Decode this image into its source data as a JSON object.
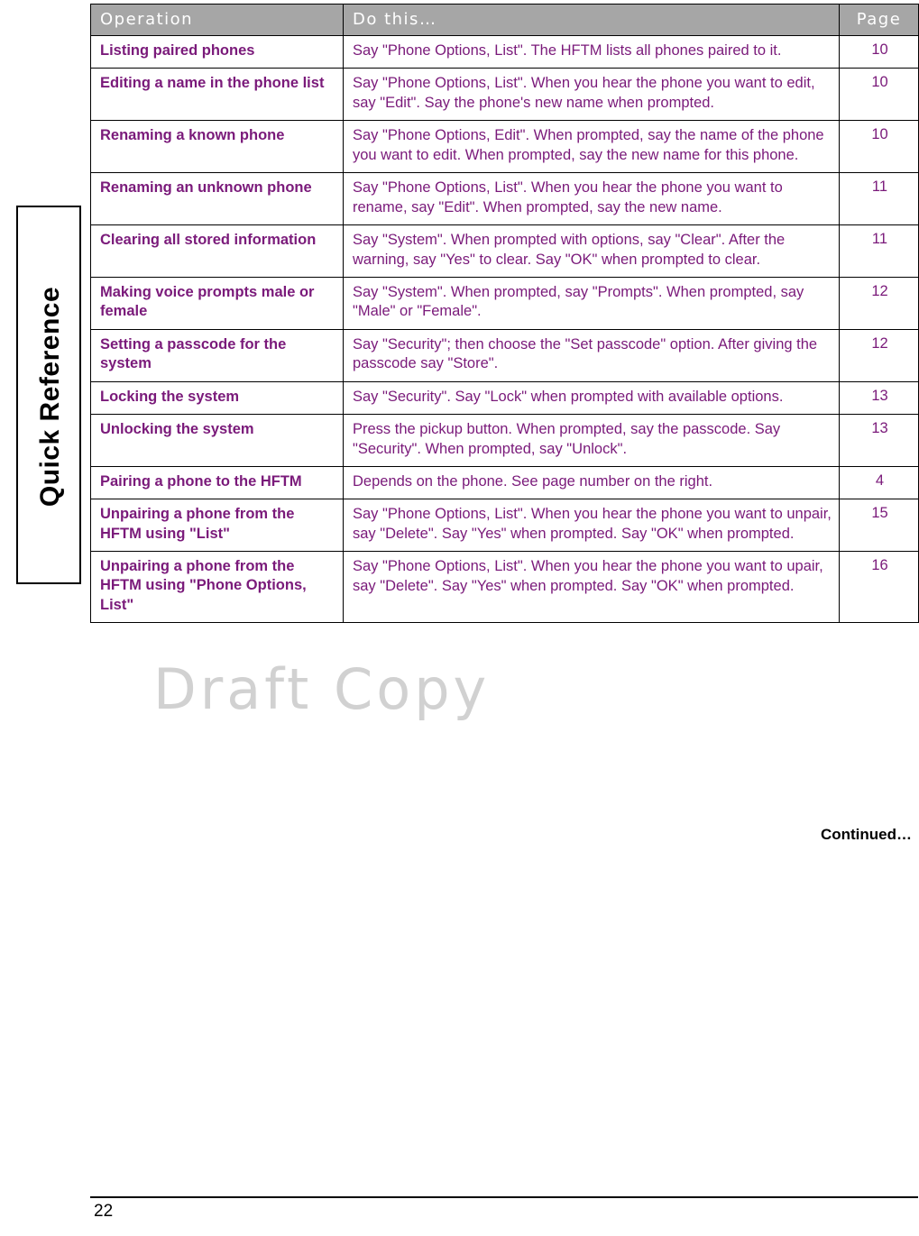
{
  "side_tab": {
    "label": "Quick Reference"
  },
  "table": {
    "headers": {
      "operation": "Operation",
      "do_this": "Do this…",
      "page": "Page"
    },
    "rows": [
      {
        "operation": "Listing paired phones",
        "do_this": "Say \"Phone Options, List\". The HFTM lists all phones paired to it.",
        "page": "10"
      },
      {
        "operation": "Editing a name in the phone list",
        "do_this": "Say \"Phone Options, List\". When you hear the phone you want to edit, say \"Edit\". Say the phone's new name when prompted.",
        "page": "10"
      },
      {
        "operation": "Renaming a known phone",
        "do_this": "Say \"Phone Options, Edit\". When prompted, say the name of the phone you want to edit. When prompted, say the new name for this phone.",
        "page": "10"
      },
      {
        "operation": "Renaming an unknown phone",
        "do_this": "Say \"Phone Options, List\". When you hear the phone you want to rename, say \"Edit\". When prompted, say the new name.",
        "page": "11"
      },
      {
        "operation": "Clearing all stored information",
        "do_this": "Say \"System\". When prompted with options, say \"Clear\". After the warning, say \"Yes\" to clear. Say \"OK\" when prompted to clear.",
        "page": "11"
      },
      {
        "operation": "Making voice prompts male or female",
        "do_this": "Say \"System\". When prompted, say \"Prompts\". When prompted, say \"Male\" or \"Female\".",
        "page": "12"
      },
      {
        "operation": "Setting a passcode for the system",
        "do_this": "Say \"Security\"; then choose the \"Set passcode\" option. After giving the passcode say \"Store\".",
        "page": "12"
      },
      {
        "operation": "Locking the system",
        "do_this": "Say \"Security\". Say \"Lock\" when prompted with available options.",
        "page": "13"
      },
      {
        "operation": "Unlocking the system",
        "do_this": "Press the pickup button. When prompted, say the passcode. Say \"Security\". When prompted, say \"Unlock\".",
        "page": "13"
      },
      {
        "operation": "Pairing a phone to the HFTM",
        "do_this": "Depends on the phone. See page number on the right.",
        "page": "4"
      },
      {
        "operation": "Unpairing a phone from the HFTM using \"List\"",
        "do_this": "Say \"Phone Options, List\". When you hear the phone you want to unpair, say \"Delete\". Say \"Yes\" when prompted. Say \"OK\" when prompted.",
        "page": "15"
      },
      {
        "operation": "Unpairing a phone from the HFTM using \"Phone Options, List\"",
        "do_this": "Say \"Phone Options, List\". When you hear the phone you want to upair, say \"Delete\". Say \"Yes\" when prompted. Say \"OK\" when prompted.",
        "page": "16"
      }
    ]
  },
  "continued_note": "Continued…",
  "watermark": "Draft Copy",
  "footer": {
    "page_number": "22"
  },
  "colors": {
    "table_text": "#7a1a7a",
    "header_bg": "#a6a6a6",
    "header_text": "#ffffff",
    "watermark": "#c9c9c9"
  }
}
